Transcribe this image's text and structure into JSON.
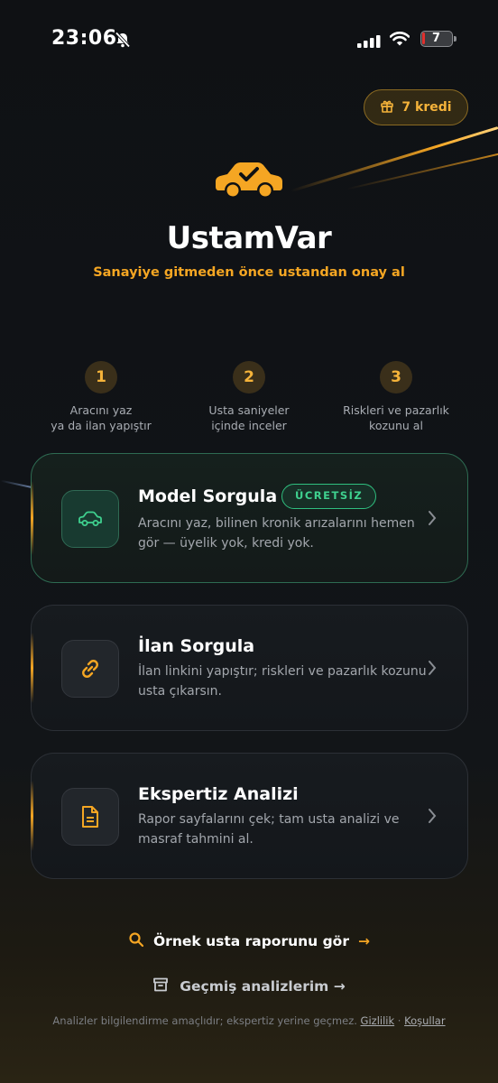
{
  "status_bar": {
    "time": "23:06",
    "battery": "7"
  },
  "header": {
    "credits_label": "7 kredi"
  },
  "brand": {
    "name": "UstamVar",
    "tagline": "Sanayiye gitmeden önce ustandan onay al"
  },
  "steps": [
    {
      "num": "1",
      "line1": "Aracını yaz",
      "line2": "ya da ilan yapıştır"
    },
    {
      "num": "2",
      "line1": "Usta saniyeler",
      "line2": "içinde inceler"
    },
    {
      "num": "3",
      "line1": "Riskleri ve pazarlık",
      "line2": "kozunu al"
    }
  ],
  "cards": [
    {
      "title": "Model Sorgula",
      "badge": "ÜCRETSİZ",
      "desc": "Aracını yaz, bilinen kronik arızalarını hemen gör — üyelik yok, kredi yok.",
      "icon": "car-icon"
    },
    {
      "title": "İlan Sorgula",
      "desc": "İlan linkini yapıştır; riskleri ve pazarlık kozunu usta çıkarsın.",
      "icon": "link-icon"
    },
    {
      "title": "Ekspertiz Analizi",
      "desc": "Rapor sayfalarını çek; tam usta analizi ve masraf tahmini al.",
      "icon": "document-icon"
    }
  ],
  "links": {
    "sample_report": "Örnek usta raporunu gör",
    "sample_arrow": "→",
    "history": "Geçmiş analizlerim →"
  },
  "footer": {
    "text": "Analizler bilgilendirme amaçlıdır; ekspertiz yerine geçmez.",
    "privacy": "Gizlilik",
    "separator": "·",
    "terms": "Koşullar"
  },
  "colors": {
    "accent": "#f5a623",
    "success": "#3fd18f",
    "background": "#0f1114"
  }
}
